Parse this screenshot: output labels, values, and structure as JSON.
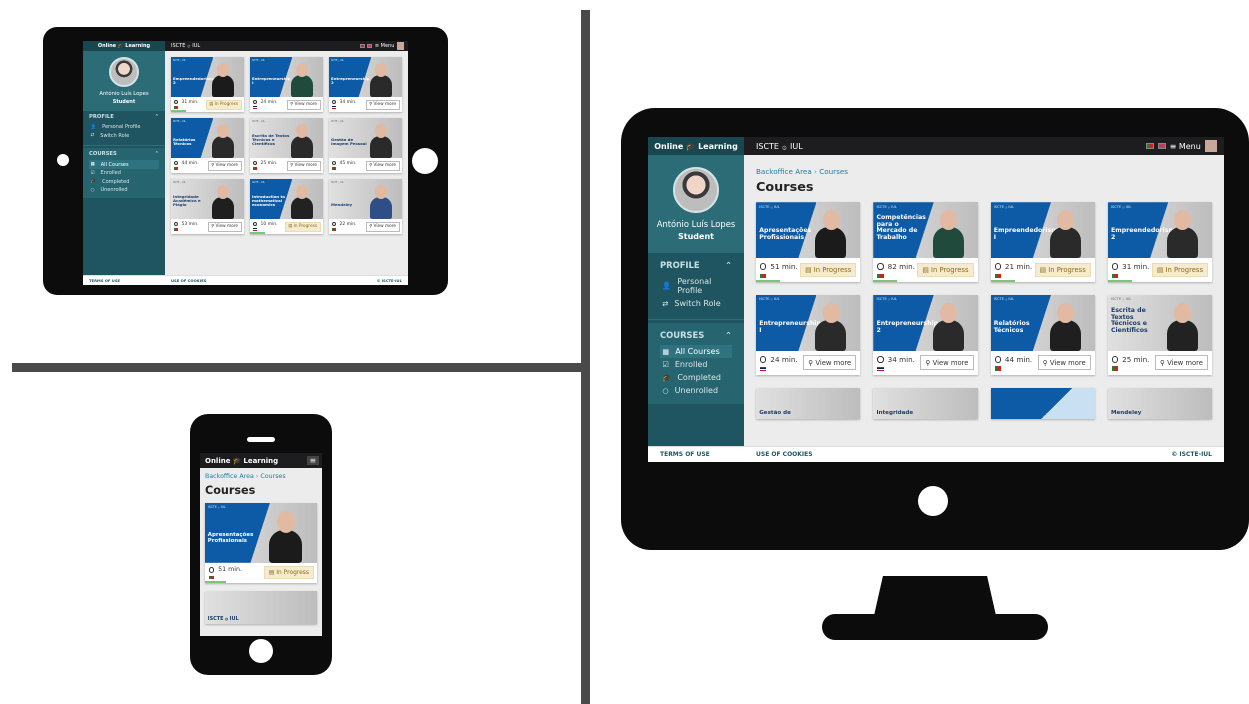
{
  "app": {
    "brand": "Online",
    "brand2": "Learning",
    "institution": "ISCTE",
    "institution2": "IUL",
    "menu_label": "Menu"
  },
  "user": {
    "name": "António Luís Lopes",
    "role": "Student"
  },
  "sidebar": {
    "profile_header": "PROFILE",
    "profile_items": [
      "Personal Profile",
      "Switch Role"
    ],
    "courses_header": "COURSES",
    "course_items": [
      "All Courses",
      "Enrolled",
      "Completed",
      "Unenrolled"
    ]
  },
  "breadcrumb": {
    "root": "Backoffice Area",
    "sep": "›",
    "current": "Courses"
  },
  "page_title": "Courses",
  "footer": {
    "terms": "TERMS OF USE",
    "cookies": "USE OF COOKIES",
    "copyright": "© ISCTE-IUL"
  },
  "buttons": {
    "in_progress": "In Progress",
    "view_more": "View more"
  },
  "desktop_courses": [
    {
      "title": "Apresentações Profissionais",
      "duration": "51 min.",
      "status": "in_progress",
      "lang": "pt"
    },
    {
      "title": "Competências para o Mercado de Trabalho",
      "duration": "82 min.",
      "status": "in_progress",
      "lang": "pt"
    },
    {
      "title": "Empreendedorismo I",
      "duration": "21 min.",
      "status": "in_progress",
      "lang": "pt"
    },
    {
      "title": "Empreendedorismo 2",
      "duration": "31 min.",
      "status": "in_progress",
      "lang": "pt"
    },
    {
      "title": "Entrepreneurship I",
      "duration": "24 min.",
      "status": "view",
      "lang": "uk"
    },
    {
      "title": "Entrepreneurship 2",
      "duration": "34 min.",
      "status": "view",
      "lang": "uk"
    },
    {
      "title": "Relatórios Técnicos",
      "duration": "44 min.",
      "status": "view",
      "lang": "pt"
    },
    {
      "title": "Escrita de Textos Técnicos e Científicos",
      "duration": "25 min.",
      "status": "view",
      "lang": "pt"
    }
  ],
  "desktop_peek": [
    "Gestão de",
    "Integridade",
    "",
    "Mendeley"
  ],
  "tablet_courses": [
    {
      "title": "Empreendedorismo 2",
      "duration": "31 min.",
      "status": "in_progress",
      "lang": "pt"
    },
    {
      "title": "Entrepreneurship I",
      "duration": "24 min.",
      "status": "view",
      "lang": "uk"
    },
    {
      "title": "Entrepreneurship 2",
      "duration": "34 min.",
      "status": "view",
      "lang": "uk"
    },
    {
      "title": "Relatórios Técnicos",
      "duration": "44 min.",
      "status": "view",
      "lang": "pt"
    },
    {
      "title": "Escrita de Textos Técnicos e Científicos",
      "duration": "25 min.",
      "status": "view",
      "lang": "pt"
    },
    {
      "title": "Gestão de Imagem Pessoal",
      "duration": "45 min.",
      "status": "view",
      "lang": "pt"
    },
    {
      "title": "Integridade Académica e Plágio",
      "duration": "53 min.",
      "status": "view",
      "lang": "pt"
    },
    {
      "title": "Introduction to mathematical economics",
      "duration": "10 min.",
      "status": "in_progress",
      "lang": "uk"
    },
    {
      "title": "Mendeley",
      "duration": "22 min.",
      "status": "view",
      "lang": "pt"
    }
  ],
  "phone_courses": [
    {
      "title": "Apresentações Profissionais",
      "duration": "51 min.",
      "status": "in_progress",
      "lang": "pt"
    }
  ],
  "colors": {
    "sidebar": "#1f5560",
    "topbar": "#1d1d1f",
    "accent_blue": "#0d5aa6",
    "progress_bg": "#f6ebcf"
  }
}
